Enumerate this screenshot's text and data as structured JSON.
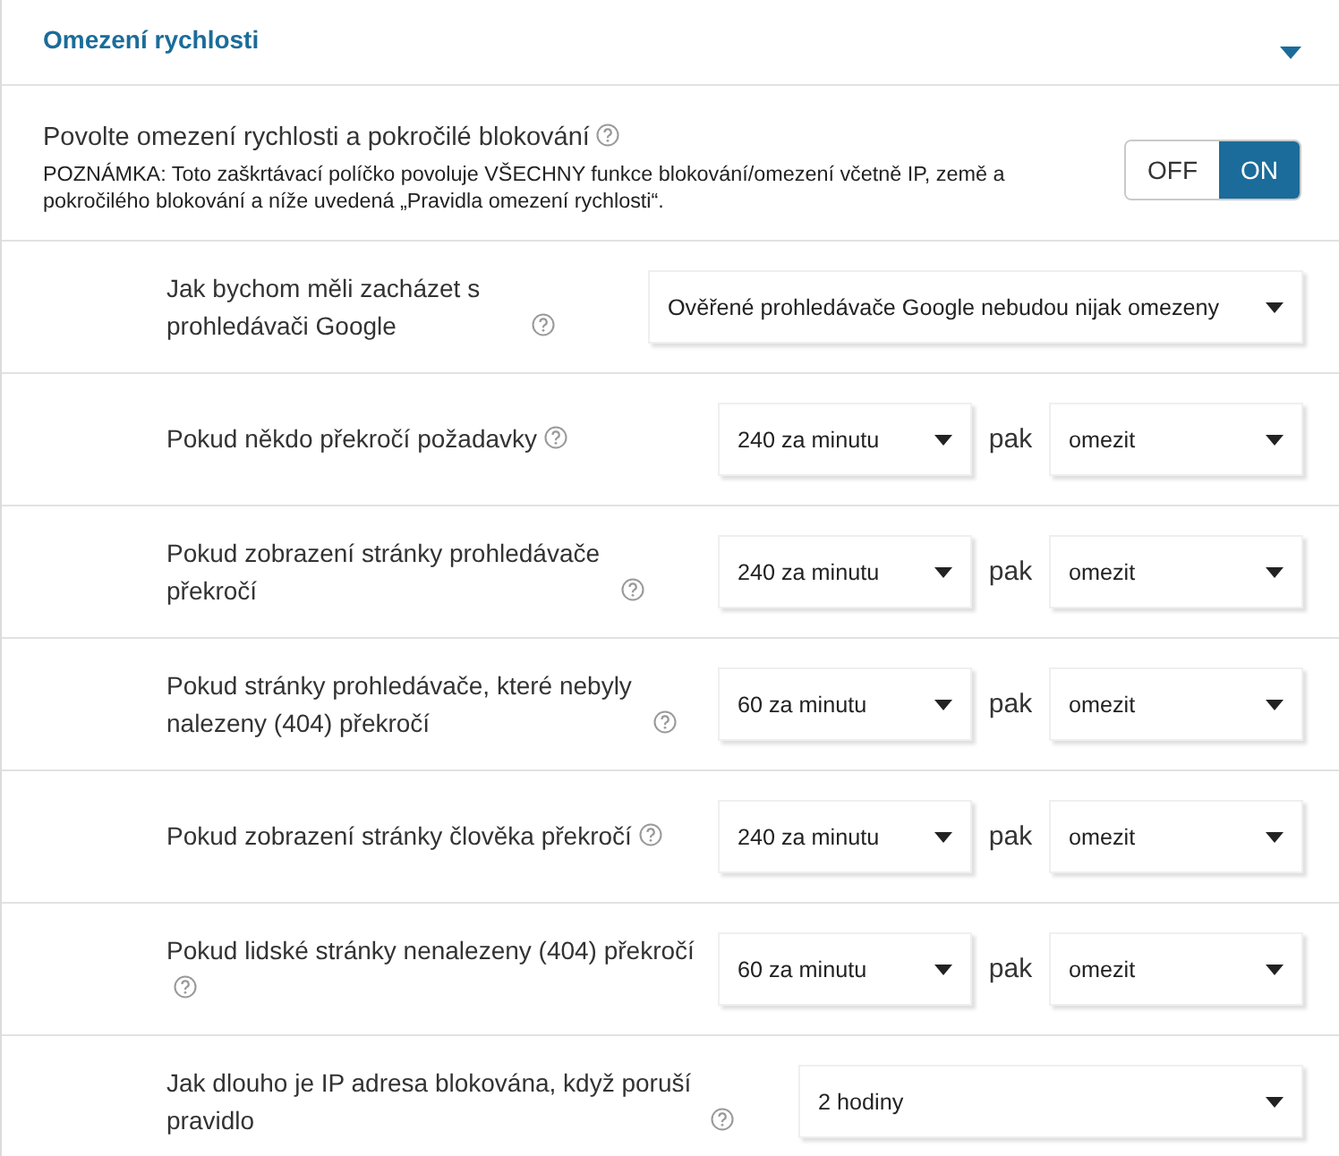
{
  "section": {
    "title": "Omezení rychlosti",
    "expanded": true
  },
  "master": {
    "label": "Povolte omezení rychlosti a pokročilé blokování",
    "note": "POZNÁMKA: Toto zaškrtávací políčko povoluje VŠECHNY funkce blokování/omezení včetně IP, země a pokročilého blokování a níže uvedená „Pravidla omezení rychlosti“.",
    "toggle": [
      {
        "label": "OFF",
        "selected": false
      },
      {
        "label": "ON",
        "selected": true
      }
    ]
  },
  "rows": [
    {
      "kind": "single",
      "label": "Jak bychom měli zacházet s prohledávači Google",
      "value": "Ověřené prohledávače Google nebudou nijak omezeny"
    },
    {
      "kind": "pair",
      "label": "Pokud někdo překročí požadavky",
      "rate": "240 za minutu",
      "joiner": "pak",
      "action": "omezit"
    },
    {
      "kind": "pair",
      "label": "Pokud zobrazení stránky prohledávače překročí",
      "rate": "240 za minutu",
      "joiner": "pak",
      "action": "omezit"
    },
    {
      "kind": "pair",
      "label": "Pokud stránky prohledávače, které nebyly nalezeny (404) překročí",
      "rate": "60 za minutu",
      "joiner": "pak",
      "action": "omezit"
    },
    {
      "kind": "pair",
      "label": "Pokud zobrazení stránky člověka překročí",
      "rate": "240 za minutu",
      "joiner": "pak",
      "action": "omezit"
    },
    {
      "kind": "pair",
      "label": "Pokud lidské stránky nenalezeny (404) překročí",
      "rate": "60 za minutu",
      "joiner": "pak",
      "action": "omezit"
    },
    {
      "kind": "single",
      "label": "Jak dlouho je IP adresa blokována, když poruší pravidlo",
      "value": "2 hodiny"
    }
  ]
}
